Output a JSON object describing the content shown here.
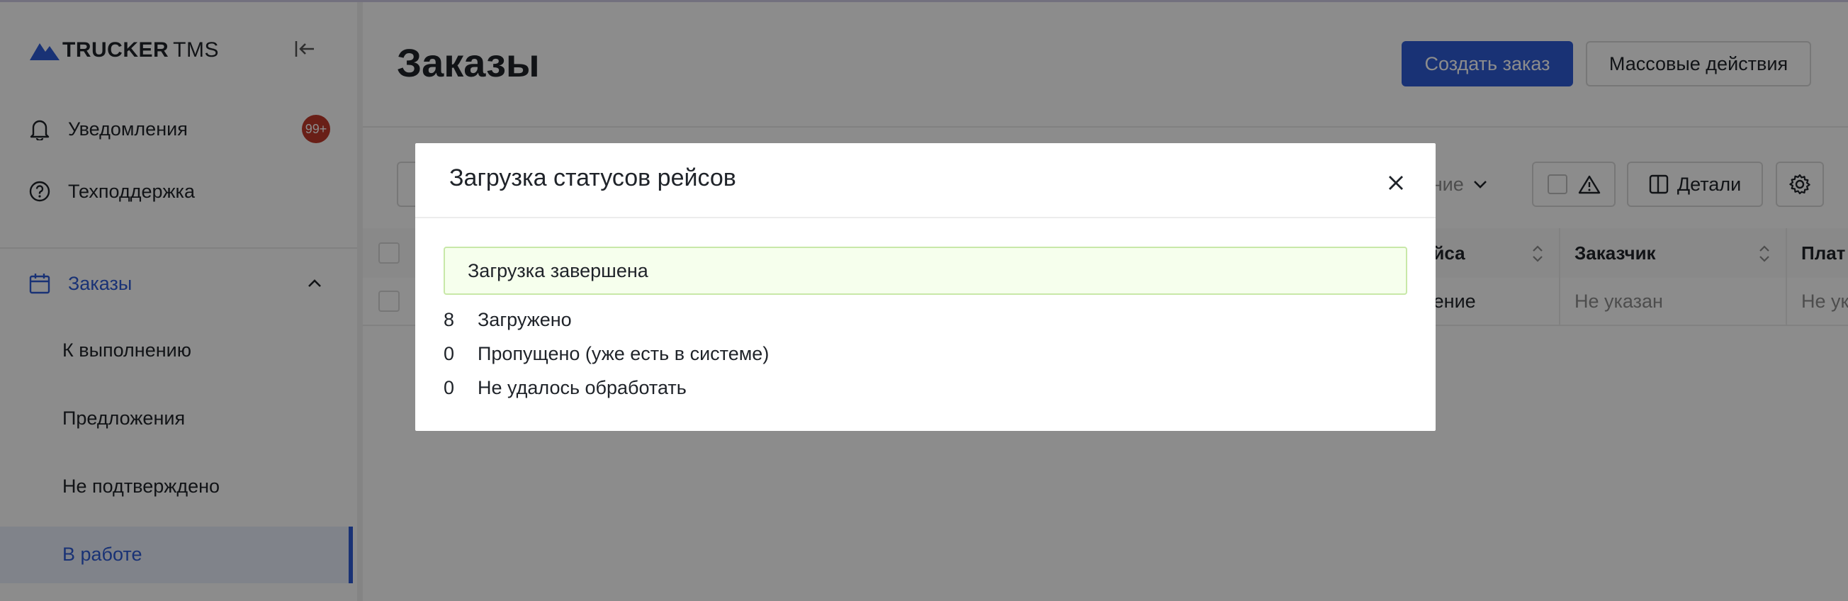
{
  "app": {
    "logo_brand": "TRUCKER",
    "logo_suffix": "TMS"
  },
  "sidebar": {
    "notifications_label": "Уведомления",
    "notifications_badge": "99+",
    "support_label": "Техподдержка",
    "orders_label": "Заказы",
    "sub_items": [
      "К выполнению",
      "Предложения",
      "Не подтверждено",
      "В работе"
    ],
    "active_sub_item": "В работе"
  },
  "header": {
    "title": "Заказы",
    "create_button": "Создать заказ",
    "bulk_button": "Массовые действия"
  },
  "toolbar": {
    "group_select_partial": "ление",
    "details_button": "Детали"
  },
  "table": {
    "headers": [
      "рейса",
      "Заказчик",
      "Плат"
    ],
    "row": [
      "лнение",
      "Не указан",
      "Не ук"
    ]
  },
  "modal": {
    "title": "Загрузка статусов рейсов",
    "alert": "Загрузка завершена",
    "stats": [
      {
        "count": "8",
        "label": "Загружено"
      },
      {
        "count": "0",
        "label": "Пропущено (уже есть в системе)"
      },
      {
        "count": "0",
        "label": "Не удалось обработать"
      }
    ]
  },
  "colors": {
    "accent": "#2f5bd6",
    "badge": "#c0392b",
    "success_bg": "#f6ffed",
    "success_border": "#c8e8a8"
  }
}
